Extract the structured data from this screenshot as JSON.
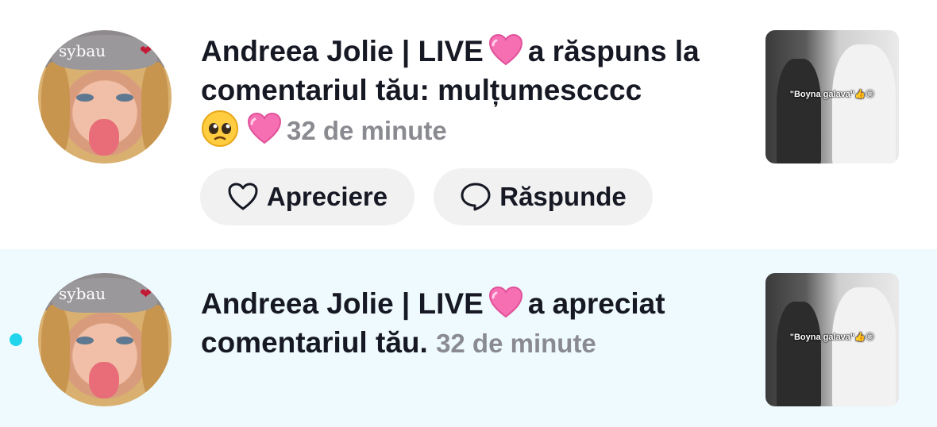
{
  "notifications": [
    {
      "avatar_text": "sybau",
      "user": "Andreea Jolie | LIVE",
      "action": "a răspuns la comentariul tău:",
      "comment": "mulțumescccc",
      "time": "32 de minute",
      "thumbnail_caption": "\"Boyna galava\"👍😏",
      "buttons": {
        "like": "Apreciere",
        "reply": "Răspunde"
      }
    },
    {
      "avatar_text": "sybau",
      "user": "Andreea Jolie | LIVE",
      "action": "a apreciat comentariul tău.",
      "time": "32 de minute",
      "thumbnail_caption": "\"Boyna galava\"👍😏",
      "unread": true
    }
  ],
  "colors": {
    "unread_dot": "#20d5ec",
    "highlight_bg": "#eefafd",
    "time_gray": "#8a8b91"
  }
}
